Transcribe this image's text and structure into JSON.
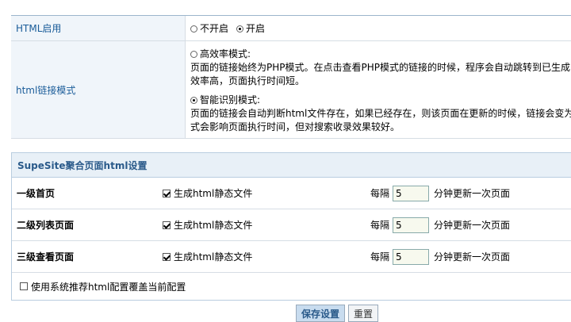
{
  "html_enable": {
    "label": "HTML启用",
    "options": [
      {
        "label": "不开启",
        "selected": false
      },
      {
        "label": "开启",
        "selected": true
      }
    ]
  },
  "link_mode": {
    "label": "html链接模式",
    "efficient": {
      "label": "高效率模式:",
      "selected": false,
      "desc_line1": "页面的链接始终为PHP模式。在点击查看PHP模式的链接的时候，程序会自动跳转到已生成",
      "desc_line2": "效率高，页面执行时间短。"
    },
    "smart": {
      "label": "智能识别模式:",
      "selected": true,
      "desc_line1": "页面的链接会自动判断html文件存在，如果已经存在，则该页面在更新的时候，链接会变为",
      "desc_line2": "式会影响页面执行时间，但对搜索收录效果较好。"
    }
  },
  "supesite": {
    "title": "SupeSite聚合页面html设置",
    "rows": [
      {
        "name": "一级首页",
        "checkbox_label": "生成html静态文件",
        "checked": true,
        "interval_prefix": "每隔",
        "interval_value": "5",
        "interval_suffix": "分钟更新一次页面"
      },
      {
        "name": "二级列表页面",
        "checkbox_label": "生成html静态文件",
        "checked": true,
        "interval_prefix": "每隔",
        "interval_value": "5",
        "interval_suffix": "分钟更新一次页面"
      },
      {
        "name": "三级查看页面",
        "checkbox_label": "生成html静态文件",
        "checked": true,
        "interval_prefix": "每隔",
        "interval_value": "5",
        "interval_suffix": "分钟更新一次页面"
      }
    ],
    "override_label": "使用系统推荐html配置覆盖当前配置",
    "override_checked": false
  },
  "buttons": {
    "save": "保存设置",
    "reset": "重置"
  }
}
